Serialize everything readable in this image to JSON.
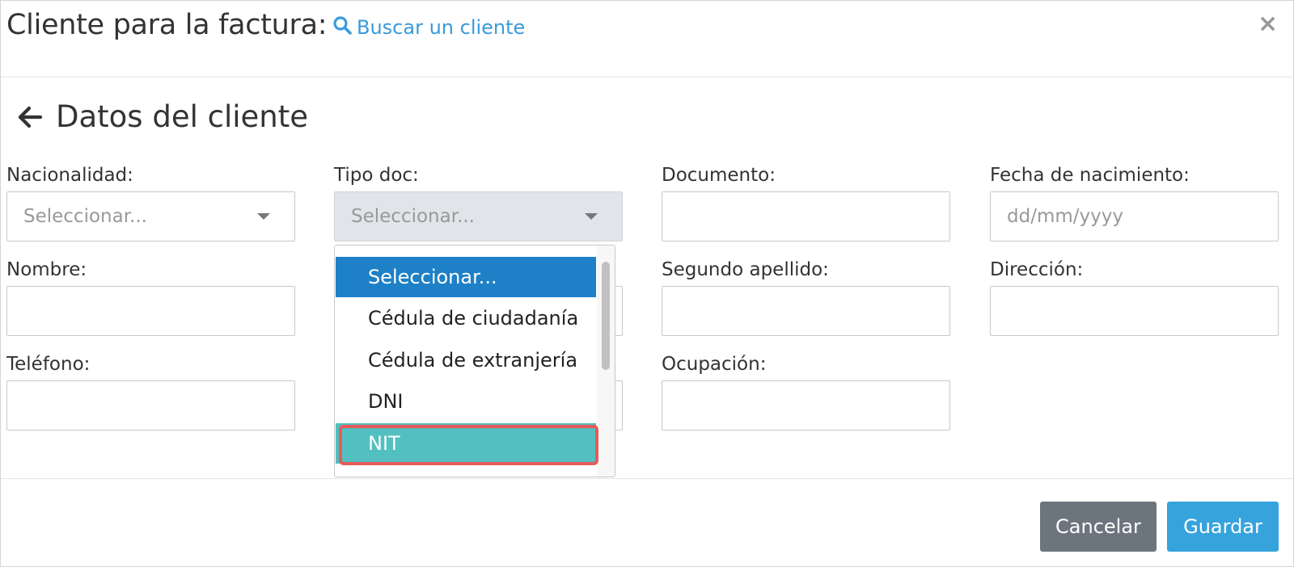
{
  "header": {
    "title": "Cliente para la factura:",
    "search_link": "Buscar un cliente",
    "close_symbol": "×"
  },
  "section": {
    "title": "Datos del cliente"
  },
  "fields": {
    "nacionalidad": {
      "label": "Nacionalidad:",
      "value": "Seleccionar..."
    },
    "tipo_doc": {
      "label": "Tipo doc:",
      "value": "Seleccionar..."
    },
    "documento": {
      "label": "Documento:",
      "value": ""
    },
    "fecha_nacimiento": {
      "label": "Fecha de nacimiento:",
      "placeholder": "dd/mm/yyyy"
    },
    "nombre": {
      "label": "Nombre:",
      "value": ""
    },
    "segundo_apellido": {
      "label": "Segundo apellido:",
      "value": ""
    },
    "direccion": {
      "label": "Dirección:",
      "value": ""
    },
    "telefono": {
      "label": "Teléfono:",
      "value": ""
    },
    "ocupacion": {
      "label": "Ocupación:",
      "value": ""
    }
  },
  "dropdown": {
    "options": [
      {
        "label": "Seleccionar...",
        "state": "selected"
      },
      {
        "label": "Cédula de ciudadanía",
        "state": "normal"
      },
      {
        "label": "Cédula de extranjería",
        "state": "normal"
      },
      {
        "label": "DNI",
        "state": "normal"
      },
      {
        "label": "NIT",
        "state": "highlighted"
      }
    ]
  },
  "footer": {
    "cancel_label": "Cancelar",
    "save_label": "Guardar"
  },
  "colors": {
    "link": "#3a9ad9",
    "selected_option": "#1e80c6",
    "highlighted_option": "#52bfc0",
    "annotation_border": "#e85a5a",
    "cancel_button": "#6c757d",
    "save_button": "#36a3dd"
  },
  "icons": {
    "search": "search-icon",
    "back": "arrow-left-icon",
    "close": "close-icon",
    "dropdown_caret": "caret-down-icon"
  }
}
